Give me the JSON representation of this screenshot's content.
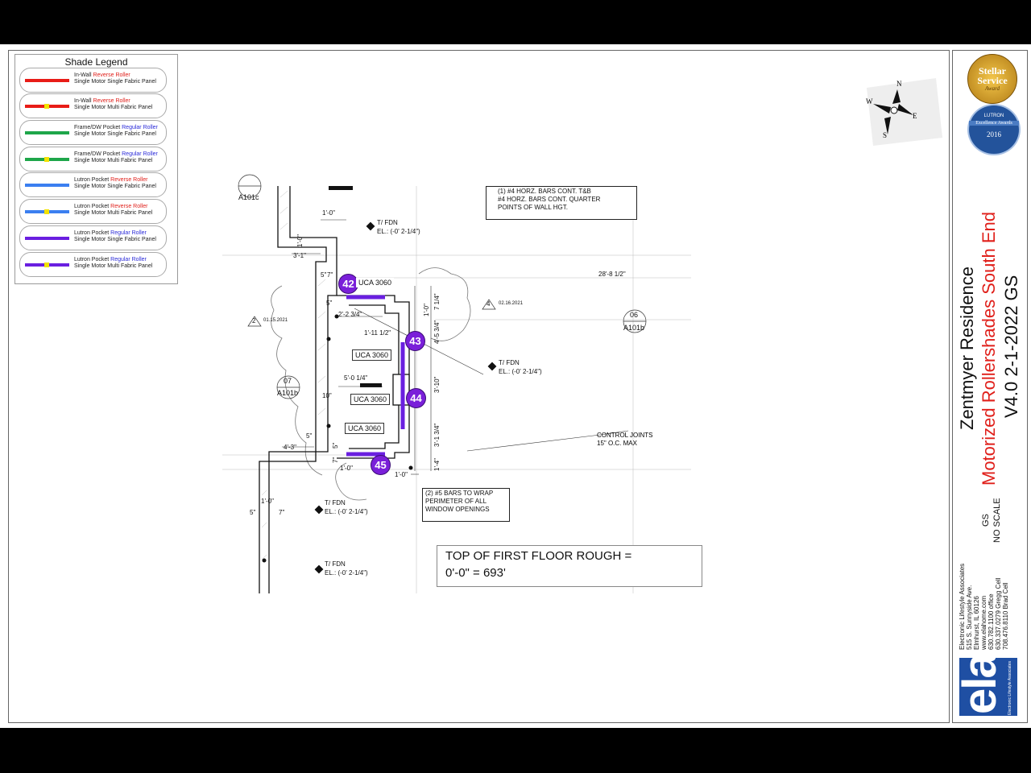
{
  "legend": {
    "title": "Shade Legend",
    "items": [
      {
        "pre": "In-Wall ",
        "hl": "Reverse Roller",
        "hlc": "red",
        "desc": "Single Motor Single Fabric Panel",
        "color": "#e81c17",
        "dot": false
      },
      {
        "pre": "In-Wall ",
        "hl": "Reverse Roller",
        "hlc": "red",
        "desc": "Single Motor Multi Fabric Panel",
        "color": "#e81c17",
        "dot": true
      },
      {
        "pre": "Frame/DW Pocket ",
        "hl": "Regular Roller",
        "hlc": "blue",
        "desc": "Single Motor Single Fabric Panel",
        "color": "#1ea64a",
        "dot": false
      },
      {
        "pre": "Frame/DW Pocket ",
        "hl": "Regular Roller",
        "hlc": "blue",
        "desc": "Single Motor Multi Fabric Panel",
        "color": "#1ea64a",
        "dot": true
      },
      {
        "pre": "Lutron Pocket ",
        "hl": "Reverse Roller",
        "hlc": "red",
        "desc": "Single Motor Single Fabric Panel",
        "color": "#3b7ff0",
        "dot": false
      },
      {
        "pre": "Lutron Pocket ",
        "hl": "Reverse Roller",
        "hlc": "red",
        "desc": "Single Motor Multi Fabric Panel",
        "color": "#3b7ff0",
        "dot": true
      },
      {
        "pre": "Lutron Pocket ",
        "hl": "Regular Roller",
        "hlc": "blue",
        "desc": "Single Motor Single Fabric Panel",
        "color": "#6a1fe0",
        "dot": false
      },
      {
        "pre": "Lutron Pocket ",
        "hl": "Regular Roller",
        "hlc": "blue",
        "desc": "Single Motor Multi Fabric Panel",
        "color": "#6a1fe0",
        "dot": true
      }
    ]
  },
  "compass": {
    "n": "N",
    "s": "S",
    "e": "E",
    "w": "W"
  },
  "plan": {
    "notes": {
      "bars": [
        "(1) #4 HORZ. BARS CONT. T&B",
        "#4 HORZ. BARS CONT. QUARTER",
        "POINTS OF WALL HGT."
      ],
      "wrap": [
        "(2) #5 BARS TO WRAP",
        "PERIMETER OF ALL",
        "WINDOW OPENINGS"
      ],
      "control_joints": [
        "CONTROL JOINTS",
        "15\" O.C. MAX"
      ],
      "floor": [
        "TOP OF FIRST FLOOR ROUGH  =",
        "0'-0\"  =  693'"
      ]
    },
    "tags": [
      "42",
      "43",
      "44",
      "45"
    ],
    "units": [
      "UCA 3060",
      "UCA 3060",
      "UCA 3060",
      "UCA 3060"
    ],
    "sections": [
      {
        "num": "",
        "ref": "A101c"
      },
      {
        "num": "07",
        "ref": "A101b"
      },
      {
        "num": "06",
        "ref": "A101b"
      }
    ],
    "revisions": [
      {
        "num": "2",
        "date": "01.15.2021"
      },
      {
        "num": "4",
        "date": "02.16.2021"
      }
    ],
    "fdn": {
      "label": "T/ FDN",
      "el": "EL.: (-0' 2-1/4\")"
    },
    "dims": {
      "d1": "1'-0\"",
      "d2": "1'-0\"",
      "d3": "3'-1\"",
      "d4": "5\"",
      "d5": "7\"",
      "d6": "5\"",
      "d7": "2'-2 3/4\"",
      "d8": "1'-11 1/2\"",
      "d9": "5'-0 1/4\"",
      "d10": "10\"",
      "d11": "5\"",
      "d12": "4'-3\"",
      "d13": "5\"",
      "d14": "7\"",
      "d15": "1'-0\"",
      "d16": "1'-0\"",
      "d17": "5\"",
      "d18": "7\"",
      "d19": "28'-8 1/2\"",
      "d20": "7 1/4\"",
      "d21": "4'-5 3/4\"",
      "d22": "1'-0\"",
      "d23": "3'-10\"",
      "d24": "3'-1 3/4\"",
      "d25": "1'-4\"",
      "d26": "1'-0\""
    }
  },
  "title_block": {
    "project": "Zentmyer Residence",
    "subtitle": "Motorized Rollershades South End",
    "version": "V4.0 2-1-2022 GS",
    "initials": "GS",
    "scale": "NO SCALE",
    "company": [
      "Electronic Lifestyle Associates",
      "515 S. Sunnyside Ave.",
      "Elmhurst, IL 60126",
      "www.elahome.com",
      "630.782.1100 office",
      "630.337.0279 Gregg Cell",
      "708.476.8110 Brad Cell"
    ],
    "logo_text": "ela",
    "logo_small": "Electronic Lifestyle Associates",
    "award1": [
      "Stellar",
      "Service",
      "Award"
    ],
    "award2": [
      "LUTRON",
      "Excellence Awards",
      "2016"
    ]
  }
}
